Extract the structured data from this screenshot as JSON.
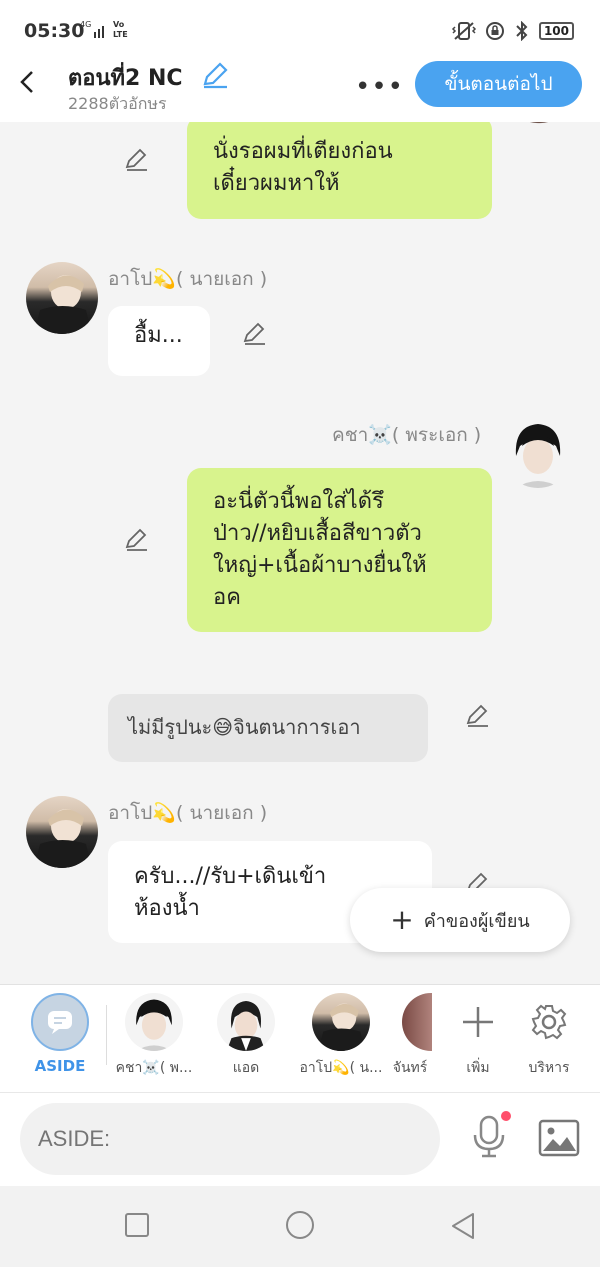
{
  "status": {
    "time": "05:30",
    "net_top": "4G",
    "volte": "Vo LTE",
    "battery": "100"
  },
  "header": {
    "title": "ตอนที่2 NC",
    "subtitle": "2288ตัวอักษร",
    "more": "•••",
    "next_button": "ขั้นตอนต่อไป"
  },
  "messages": [
    {
      "type": "right",
      "text": "นั่งรอผมที่เตียงก่อน\nเดี๋ยวผมหาให้"
    },
    {
      "type": "left",
      "name": "อาโป💫( นายเอก )",
      "text": "อื้ม..."
    },
    {
      "type": "right",
      "name": "คชา☠️( พระเอก )",
      "text": "อะนี่ตัวนี้พอใส่ได้รึ\nป่าว//หยิบเสื้อสีขาวตัว\nใหญ่+เนื้อผ้าบางยื่นให้\nอค"
    },
    {
      "type": "aside",
      "text": "ไม่มีรูปนะ😅จินตนาการเอา"
    },
    {
      "type": "left",
      "name": "อาโป💫( นายเอก )",
      "text": "ครับ...//รับ+เดินเข้า\nห้องน้ำ"
    }
  ],
  "author_button": "คำของผู้เขียน",
  "characters": {
    "aside": "ASIDE",
    "items": [
      "คชา☠️( พ...",
      "แอด",
      "อาโป💫( น...",
      "จันทร์"
    ],
    "add": "เพิ่ม",
    "manage": "บริหาร"
  },
  "input": {
    "placeholder": "ASIDE:"
  },
  "colors": {
    "accent": "#4aa3f0",
    "bubble_green": "#d8f38d"
  }
}
